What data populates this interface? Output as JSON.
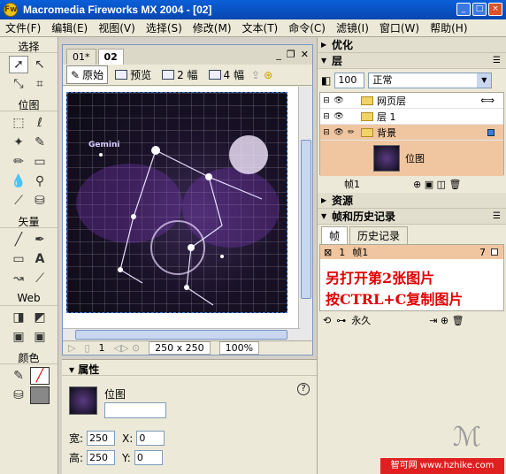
{
  "window": {
    "title": "Macromedia Fireworks MX 2004 - [02]",
    "controls": [
      "_",
      "□",
      "×"
    ]
  },
  "menu": [
    "文件(F)",
    "编辑(E)",
    "视图(V)",
    "选择(S)",
    "修改(M)",
    "文本(T)",
    "命令(C)",
    "滤镜(I)",
    "窗口(W)",
    "帮助(H)"
  ],
  "tools": {
    "sections": [
      "选择",
      "位图",
      "矢量",
      "Web",
      "颜色"
    ]
  },
  "document": {
    "tabs": [
      "01*",
      "02"
    ],
    "view_buttons": [
      "原始",
      "预览",
      "2 幅",
      "4 幅"
    ],
    "canvas_label": "Gemini",
    "frame_number": "1",
    "size": "250 x 250",
    "zoom": "100%"
  },
  "properties": {
    "title": "属性",
    "object_type": "位图",
    "width_label": "宽:",
    "width": "250",
    "height_label": "高:",
    "height": "250",
    "x_label": "X:",
    "x": "0",
    "y_label": "Y:",
    "y": "0",
    "help": "?"
  },
  "panels": {
    "optimize": "优化",
    "layers": {
      "title": "层",
      "opacity": "100",
      "blend": "正常",
      "rows": [
        {
          "name": "网页层"
        },
        {
          "name": "层 1"
        },
        {
          "name": "背景"
        }
      ],
      "sub_item": "位图",
      "footer": "帧1"
    },
    "assets": "资源",
    "frames_history": {
      "title": "帧和历史记录",
      "tabs": [
        "帧",
        "历史记录"
      ],
      "frame_row": {
        "index": "1",
        "name": "帧1",
        "delay": "7"
      },
      "annotation_1": "另打开第2张图片",
      "annotation_2": "按CTRL+C复制图片",
      "loop": "永久"
    }
  },
  "watermark": "智可网 www.hzhike.com"
}
